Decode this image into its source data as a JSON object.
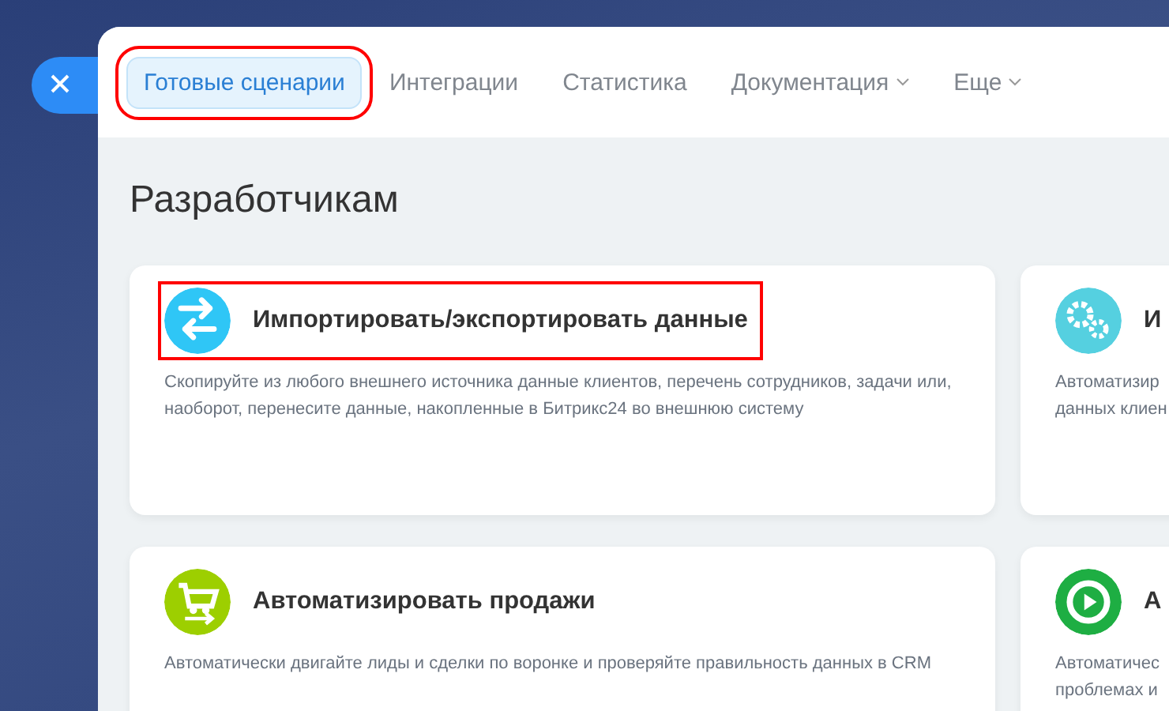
{
  "tabs": [
    {
      "label": "Готовые сценарии",
      "selected": true,
      "highlighted": true,
      "dropdown": false
    },
    {
      "label": "Интеграции",
      "selected": false,
      "highlighted": false,
      "dropdown": false
    },
    {
      "label": "Статистика",
      "selected": false,
      "highlighted": false,
      "dropdown": false
    },
    {
      "label": "Документация",
      "selected": false,
      "highlighted": false,
      "dropdown": true
    },
    {
      "label": "Еще",
      "selected": false,
      "highlighted": false,
      "dropdown": true
    }
  ],
  "heading": "Разработчикам",
  "cards": [
    {
      "kind": "arrows",
      "color": "#2fc6f6",
      "title": "Импортировать/экспортировать данные",
      "description": "Скопируйте из любого внешнего источника данные клиентов, перечень сотрудников, задачи или, наоборот, перенесите данные, накопленные в Битрикс24 во внешнюю систему",
      "highlighted": true
    },
    {
      "kind": "gears",
      "color": "#55d0e0",
      "title": "И",
      "description": "Автоматизир\nданных клиен",
      "highlighted": false
    },
    {
      "kind": "cart",
      "color": "#9dcf00",
      "title": "Автоматизировать продажи",
      "description": "Автоматически двигайте лиды и сделки по воронке и проверяйте правильность данных в CRM",
      "highlighted": false
    },
    {
      "kind": "play",
      "color": "#1eae43",
      "title": "А",
      "description": "Автоматичес\nпроблемах и",
      "highlighted": false
    }
  ]
}
